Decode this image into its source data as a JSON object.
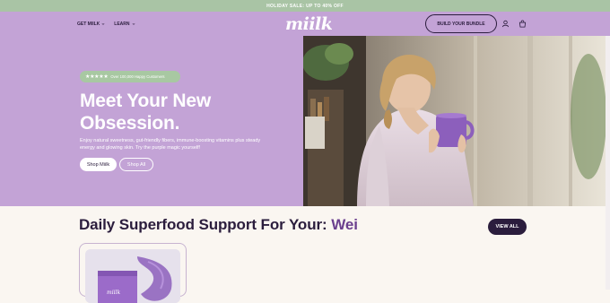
{
  "promo": {
    "text": "HOLIDAY SALE: UP TO 40% OFF"
  },
  "nav": {
    "links": [
      {
        "label": "GET MIILK"
      },
      {
        "label": "LEARN"
      }
    ],
    "logo": "miilk",
    "bundle_label": "BUILD YOUR BUNDLE",
    "icons": [
      "user-icon",
      "cart-icon"
    ]
  },
  "hero": {
    "stars": "★★★★★",
    "badge": "Over 100,000 Happy Customers",
    "headline": "Meet Your New Obsession.",
    "subtext": "Enjoy natural sweetness, gut-friendly fibers, immune-boosting vitamins plus steady energy and glowing skin. Try the purple magic yourself!",
    "shop_milk": "Shop Miilk",
    "shop_all": "Shop All"
  },
  "section": {
    "title": "Daily Superfood Support For Your:",
    "accent_word": "Wei",
    "view_all": "VIEW ALL"
  },
  "product": {
    "brand_mark": "miilk"
  },
  "colors": {
    "lavender": "#c3a3d6",
    "sage": "#a8c8a2",
    "dark": "#2b1d3d",
    "cream": "#faf6f1"
  }
}
